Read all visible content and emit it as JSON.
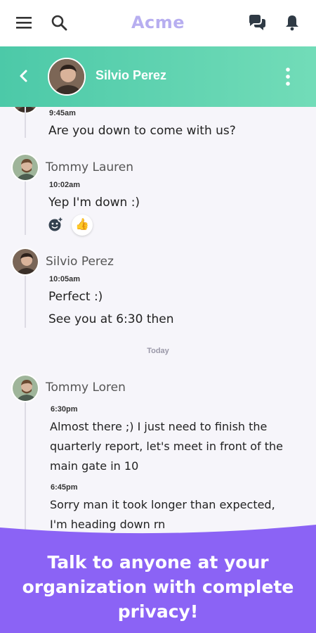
{
  "app": {
    "brand": "Acme"
  },
  "topbar": {
    "icons": [
      "menu-icon",
      "search-icon",
      "chat-bubbles-icon",
      "bell-icon"
    ]
  },
  "chat": {
    "contact_name": "Silvio Perez"
  },
  "messages": {
    "m0": {
      "time": "9:45am",
      "text": "Are you down to come with us?"
    },
    "g1": {
      "sender": "Tommy Lauren",
      "time": "10:02am",
      "text": "Yep I'm down :)",
      "reaction": "👍"
    },
    "g2": {
      "sender": "Silvio Perez",
      "time": "10:05am",
      "text1": "Perfect :)",
      "text2": "See you at 6:30 then"
    },
    "separator": "Today",
    "g3": {
      "sender": "Tommy Loren",
      "time1": "6:30pm",
      "line1": "Almost there ;) I just need to finish the",
      "line2": "quarterly report, let's meet in front of the",
      "line3": "main gate in 10",
      "time2": "6:45pm",
      "line4": "Sorry man it took longer than expected,",
      "line5": "I'm heading down rn"
    }
  },
  "promo": {
    "line1": "Talk to anyone at your",
    "line2": "organization with complete",
    "line3": "privacy!",
    "color": "#8b63f5"
  },
  "colors": {
    "header_green": "#4cc9a8",
    "brand": "#b7aef0",
    "promo": "#8b63f5"
  }
}
